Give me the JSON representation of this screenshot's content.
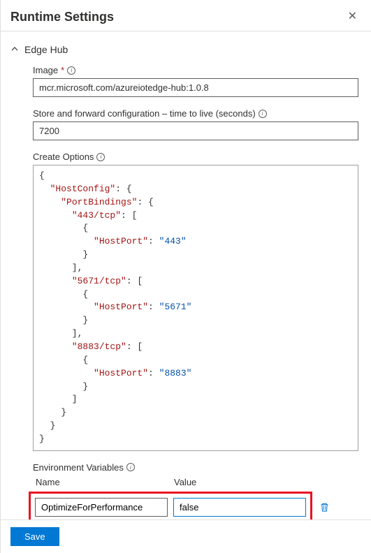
{
  "header": {
    "title": "Runtime Settings"
  },
  "section": {
    "title": "Edge Hub",
    "expanded": true
  },
  "fields": {
    "image": {
      "label": "Image",
      "required_marker": "*",
      "value": "mcr.microsoft.com/azureiotedge-hub:1.0.8"
    },
    "ttl": {
      "label": "Store and forward configuration – time to live (seconds)",
      "value": "7200"
    },
    "create_options": {
      "label": "Create Options",
      "json": {
        "HostConfig": {
          "PortBindings": {
            "443/tcp": [
              {
                "HostPort": "443"
              }
            ],
            "5671/tcp": [
              {
                "HostPort": "5671"
              }
            ],
            "8883/tcp": [
              {
                "HostPort": "8883"
              }
            ]
          }
        }
      }
    },
    "env_vars": {
      "label": "Environment Variables",
      "columns": {
        "name": "Name",
        "value": "Value"
      },
      "rows": [
        {
          "name": "OptimizeForPerformance",
          "value": "false"
        }
      ]
    }
  },
  "footer": {
    "save_label": "Save"
  },
  "icons": {
    "close": "✕",
    "info": "i",
    "chevron_up": "⌃"
  }
}
